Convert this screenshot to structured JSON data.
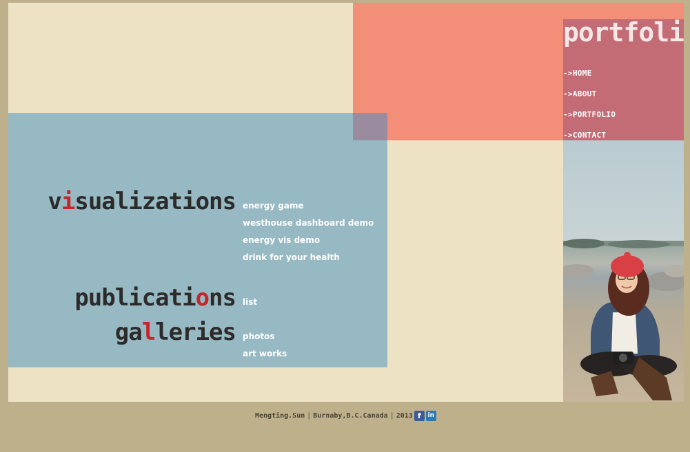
{
  "nav": {
    "title": "portfolio",
    "items": [
      {
        "label": "->HOME"
      },
      {
        "label": "->ABOUT"
      },
      {
        "label": "->PORTFOLIO"
      },
      {
        "label": "->CONTACT"
      }
    ]
  },
  "sections": {
    "visualizations": {
      "title_before": "v",
      "title_accent": "i",
      "title_after": "sualizations",
      "links": [
        "energy game",
        "westhouse dashboard demo",
        "energy vis demo",
        "drink for your health"
      ]
    },
    "publications": {
      "title_before": "publicati",
      "title_accent": "o",
      "title_after": "ns",
      "links": [
        "list"
      ]
    },
    "galleries": {
      "title_before": "ga",
      "title_accent": "l",
      "title_after": "leries",
      "links": [
        "photos",
        "art works"
      ]
    }
  },
  "footer": {
    "name": "Mengting.Sun",
    "location": "Burnaby,B.C.Canada",
    "year": "2013",
    "separator": "|",
    "social": [
      {
        "icon": "facebook-icon",
        "glyph": "f"
      },
      {
        "icon": "linkedin-icon",
        "glyph": "in"
      }
    ]
  },
  "colors": {
    "background": "#bfb08c",
    "cream": "#ede3c4",
    "blue": "#97b9c3",
    "coral": "#f38f79",
    "nav_panel": "#c46c76",
    "accent": "#c8252a"
  }
}
